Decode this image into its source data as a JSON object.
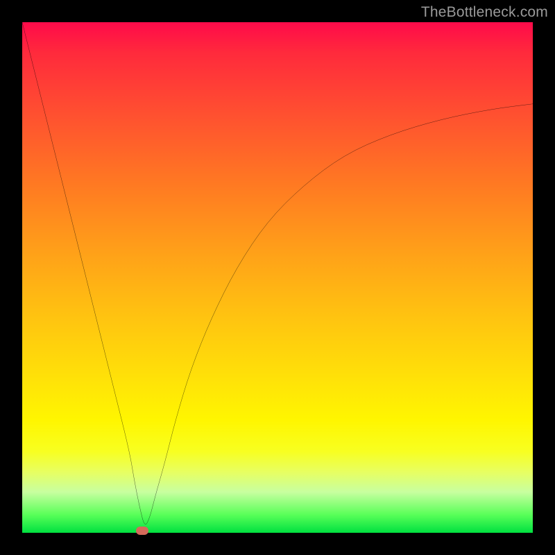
{
  "watermark": "TheBottleneck.com",
  "chart_data": {
    "type": "line",
    "title": "",
    "xlabel": "",
    "ylabel": "",
    "xlim": [
      0,
      100
    ],
    "ylim": [
      0,
      100
    ],
    "grid": false,
    "legend": false,
    "background_gradient": {
      "orientation": "vertical",
      "stops": [
        {
          "pos": 0.0,
          "color": "#ff0a4a"
        },
        {
          "pos": 0.5,
          "color": "#ffb000"
        },
        {
          "pos": 0.8,
          "color": "#fff000"
        },
        {
          "pos": 1.0,
          "color": "#00e040"
        }
      ]
    },
    "series": [
      {
        "name": "bottleneck-curve",
        "color": "#000000",
        "x": [
          0,
          3,
          6,
          9,
          12,
          15,
          18,
          21,
          22,
          23,
          24,
          25,
          26,
          28,
          30,
          33,
          37,
          42,
          48,
          55,
          63,
          72,
          82,
          92,
          100
        ],
        "y": [
          100,
          88,
          76,
          64,
          52,
          40,
          28,
          16,
          10,
          5,
          1,
          3,
          7,
          14,
          22,
          32,
          42,
          52,
          61,
          68,
          74,
          78,
          81,
          83,
          84
        ]
      }
    ],
    "marker": {
      "name": "optimum-point",
      "x": 23.5,
      "y": 0,
      "color": "#d46a5a",
      "shape": "rounded-rect"
    }
  }
}
